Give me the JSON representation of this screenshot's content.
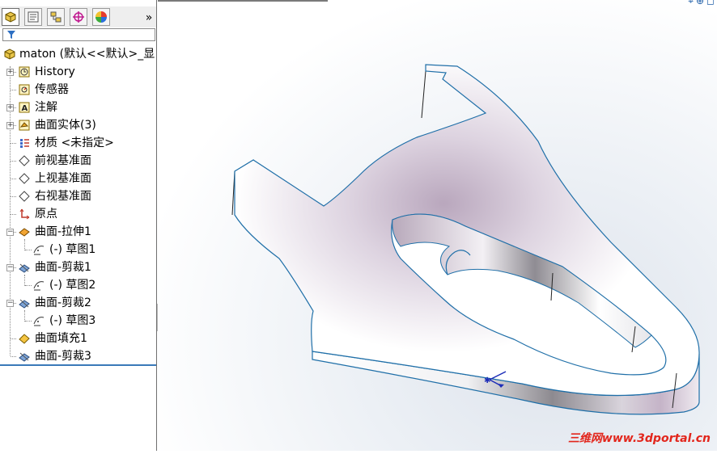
{
  "panel": {
    "tabs": [
      {
        "name": "feature-manager-tab",
        "icon": "feature-tree-icon",
        "active": true
      },
      {
        "name": "property-manager-tab",
        "icon": "property-icon",
        "active": false
      },
      {
        "name": "configuration-manager-tab",
        "icon": "configuration-icon",
        "active": false
      },
      {
        "name": "dimxpert-tab",
        "icon": "crosshair-icon",
        "active": false
      },
      {
        "name": "display-manager-tab",
        "icon": "color-wheel-icon",
        "active": false
      }
    ],
    "expand_label": "»",
    "root_label": "maton  (默认<<默认>_显"
  },
  "tree": [
    {
      "label": "History",
      "icon": "history-icon",
      "expandable": true
    },
    {
      "label": "传感器",
      "icon": "sensor-icon",
      "expandable": false
    },
    {
      "label": "注解",
      "icon": "annotation-icon",
      "expandable": true
    },
    {
      "label": "曲面实体(3)",
      "icon": "surface-bodies-icon",
      "expandable": true
    },
    {
      "label": "材质 <未指定>",
      "icon": "material-icon",
      "expandable": false
    },
    {
      "label": "前视基准面",
      "icon": "plane-icon",
      "expandable": false
    },
    {
      "label": "上视基准面",
      "icon": "plane-icon",
      "expandable": false
    },
    {
      "label": "右视基准面",
      "icon": "plane-icon",
      "expandable": false
    },
    {
      "label": "原点",
      "icon": "origin-icon",
      "expandable": false
    },
    {
      "label": "曲面-拉伸1",
      "icon": "surface-extrude-icon",
      "expandable": true,
      "expanded": true
    },
    {
      "label": "(-) 草图1",
      "icon": "sketch-icon",
      "child": true
    },
    {
      "label": "曲面-剪裁1",
      "icon": "surface-trim-icon",
      "expandable": true,
      "expanded": true
    },
    {
      "label": "(-) 草图2",
      "icon": "sketch-icon",
      "child": true
    },
    {
      "label": "曲面-剪裁2",
      "icon": "surface-trim-icon",
      "expandable": true,
      "expanded": true
    },
    {
      "label": "(-) 草图3",
      "icon": "sketch-icon",
      "child": true
    },
    {
      "label": "曲面填充1",
      "icon": "surface-fill-icon",
      "expandable": false
    },
    {
      "label": "曲面-剪裁3",
      "icon": "surface-trim-icon",
      "expandable": false
    }
  ],
  "viewport": {
    "model": "saddle-shaped-surface-body",
    "triad": "coordinate-triad-icon"
  },
  "watermark": "三维网www.3dportal.cn",
  "colors": {
    "edge": "#1f6fa8",
    "rollback_bar": "#3a79b9",
    "surface_shade": "#c9bccd"
  }
}
